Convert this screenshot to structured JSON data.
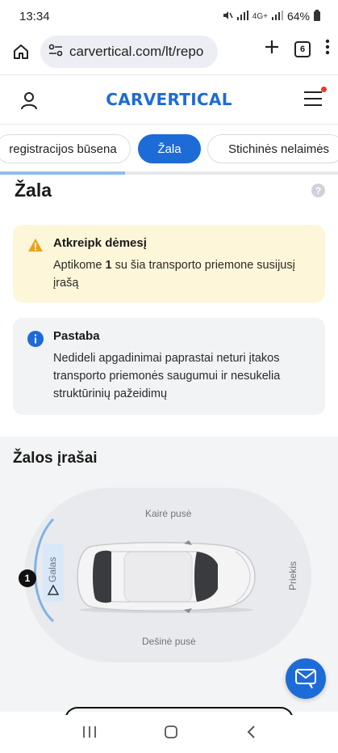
{
  "status_bar": {
    "time": "13:34",
    "network": "4G+",
    "battery": "64%"
  },
  "browser": {
    "url": "carvertical.com/lt/repo",
    "tab_count": "6"
  },
  "site": {
    "logo": "CARVERTICAL"
  },
  "category_tabs": [
    {
      "label": "registracijos būsena",
      "active": false
    },
    {
      "label": "Žala",
      "active": true
    },
    {
      "label": "Stichinės nelaimės",
      "active": false
    }
  ],
  "scroll_progress": 0.37,
  "section": {
    "title": "Žala"
  },
  "warning": {
    "title": "Atkreipk dėmesį",
    "text_before": "Aptikome ",
    "count": "1",
    "text_after": " su šia transporto priemone susijusį įrašą"
  },
  "note": {
    "title": "Pastaba",
    "text": "Nedideli apgadinimai paprastai neturi įtakos transporto priemonės saugumui ir nesukelia struktūrinių pažeidimų"
  },
  "damage_records": {
    "title": "Žalos įrašai",
    "left_side": "Kairė pusė",
    "right_side": "Dešinė pusė",
    "front": "Priekis",
    "rear": "Galas",
    "rear_count": "1"
  },
  "colors": {
    "brand": "#1d6bd7",
    "warning_bg": "#fdf6d8",
    "info_bg": "#f2f3f5",
    "warning_icon": "#e8a317"
  }
}
